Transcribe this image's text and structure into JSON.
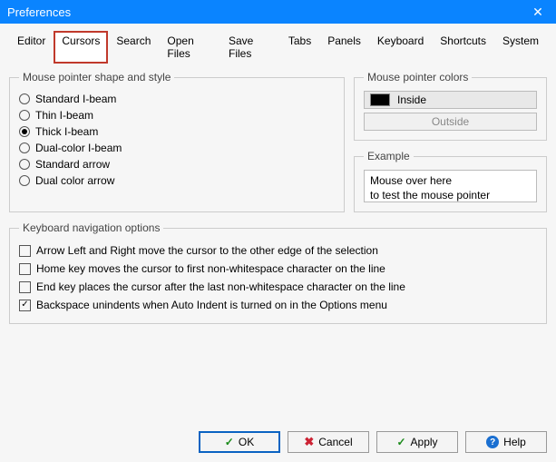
{
  "window": {
    "title": "Preferences",
    "close_glyph": "✕"
  },
  "tabs": [
    "Editor",
    "Cursors",
    "Search",
    "Open Files",
    "Save Files",
    "Tabs",
    "Panels",
    "Keyboard",
    "Shortcuts",
    "System"
  ],
  "active_tab_index": 1,
  "shape_group": {
    "legend": "Mouse pointer shape and style",
    "options": [
      {
        "label": "Standard I-beam",
        "checked": false
      },
      {
        "label": "Thin I-beam",
        "checked": false
      },
      {
        "label": "Thick I-beam",
        "checked": true
      },
      {
        "label": "Dual-color I-beam",
        "checked": false
      },
      {
        "label": "Standard arrow",
        "checked": false
      },
      {
        "label": "Dual color arrow",
        "checked": false
      }
    ]
  },
  "colors_group": {
    "legend": "Mouse pointer colors",
    "items": [
      {
        "label": "Inside",
        "swatch": "#000000",
        "selected": true
      },
      {
        "label": "Outside",
        "swatch": null,
        "selected": false
      }
    ]
  },
  "example_group": {
    "legend": "Example",
    "line1": "Mouse over here",
    "line2": "to test the mouse pointer"
  },
  "keyboard_group": {
    "legend": "Keyboard navigation options",
    "options": [
      {
        "label": "Arrow Left and Right move the cursor to the other edge of the selection",
        "checked": false
      },
      {
        "label": "Home key moves the cursor to first non-whitespace character on the line",
        "checked": false
      },
      {
        "label": "End key places the cursor after the last non-whitespace character on the line",
        "checked": false
      },
      {
        "label": "Backspace unindents when Auto Indent is turned on in the Options menu",
        "checked": true
      }
    ]
  },
  "buttons": {
    "ok": "OK",
    "cancel": "Cancel",
    "apply": "Apply",
    "help": "Help"
  }
}
